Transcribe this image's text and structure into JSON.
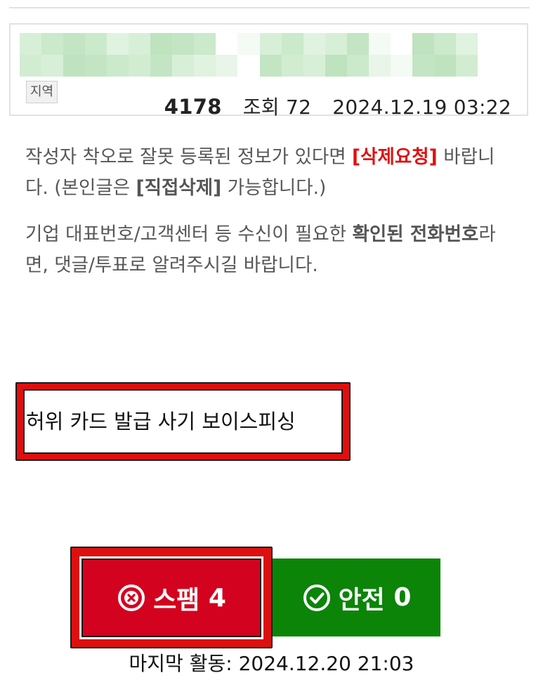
{
  "post": {
    "region_tag": "지역",
    "number": "4178",
    "views_label": "조회",
    "views": "72",
    "datetime": "2024.12.19 03:22"
  },
  "notice": {
    "line1_prefix": "작성자 착오로 잘못 등록된 정보가 있다면 ",
    "delete_request": "[삭제요청]",
    "line1_mid": " 바랍니다. (본인글은 ",
    "direct_delete": "[직접삭제]",
    "line1_suffix": " 가능합니다.)",
    "line2_prefix": "기업 대표번호/고객센터 등 수신이 필요한 ",
    "verified_phone": "확인된 전화번호",
    "line2_suffix": "라면, 댓글/투표로 알려주시길 바랍니다."
  },
  "category": {
    "label": "허위 카드 발급 사기 보이스피싱"
  },
  "votes": {
    "spam_label": "스팸",
    "spam_count": "4",
    "safe_label": "안전",
    "safe_count": "0"
  },
  "last_activity": {
    "label": "마지막 활동:",
    "datetime": "2024.12.20 21:03"
  },
  "colors": {
    "spam": "#d3021f",
    "safe": "#0b8408",
    "highlight_border": "#e00e0e",
    "delete_request_text": "#e01010"
  }
}
